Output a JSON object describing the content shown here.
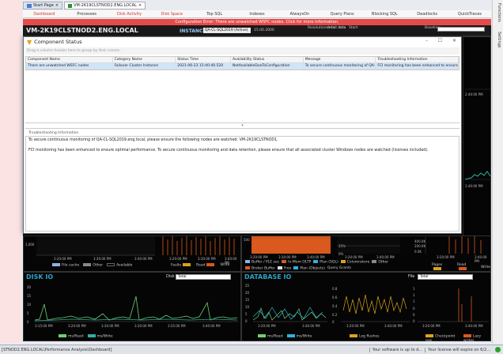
{
  "tabs": [
    {
      "label": "Start Page"
    },
    {
      "label": "VM-2K19CLSTNOD2.ENG.LOCAL"
    }
  ],
  "nav": [
    "Dashboard",
    "Processes",
    "Disk Activity",
    "Disk Space",
    "Top SQL",
    "Indexes",
    "AlwaysOn",
    "Query Plans",
    "Blocking SQL",
    "Deadlocks",
    "QuickTraces"
  ],
  "error_text": "Configuration Error: There are unwatched WSFC nodes. Click for more information.",
  "server": {
    "name": "VM-2K19CLSTNOD2.ENG.LOCAL",
    "instance_label": "INSTANCE",
    "instance_value": "QA-CL-SQL2019 (Active)",
    "date": "15.00.2000",
    "resolution_label": "Resolution:",
    "resolution_value": "detail data",
    "start_label": "Start:",
    "baseline_label": "Baseline:"
  },
  "right_labels": {
    "functions": "Functions",
    "settings": "Settings"
  },
  "modal": {
    "title": "Component Status",
    "group_hint": "Drag a column header here to group by that column",
    "columns": [
      "Component Name",
      "Category Name",
      "Status Time",
      "Availability Status",
      "Message",
      "Troubleshooting Information"
    ],
    "rows": [
      [
        "There are unwatched WSFC nodes",
        "Failover Cluster Instance",
        "2021-06-23 15:40:40.520",
        "NotAvailableDueToConfiguration",
        "To secure continuous monitoring of QA-C...",
        "FCI monitoring has been enhanced to ensure ..."
      ]
    ],
    "ts_header": "Troubleshooting Information",
    "ts_lines": [
      "To secure continuous monitoring of QA-CL-SQL2019.eng.local, please ensure the following nodes are watched: VM-2K19CLSTNOD1.",
      "FCI monitoring has been enhanced to ensure optimal performance. To secure continuous monitoring and data retention, please ensure that all associated cluster Windows nodes are watched (licenses included)."
    ]
  },
  "memory_panel": {
    "tick_left": "1,000",
    "times": [
      "3:20:00 PM",
      "3:30:00 PM",
      "3:40:00 PM"
    ],
    "legend": [
      "File cache",
      "Other",
      "Available"
    ],
    "legend2": [
      "Faults",
      "Read",
      "Write"
    ]
  },
  "sql_panel": {
    "tick": "500",
    "times": [
      "3:20:00 PM",
      "3:30:00 PM",
      "3:40:00 PM"
    ],
    "pct": [
      "25%",
      "0%"
    ],
    "legend": [
      "Buffer / PLE sec",
      "In-Mem OLTP",
      "Plan (SQL)",
      "Columnstore",
      "Other",
      "Broker Buffer",
      "Free",
      "Plan (Objects)",
      "Query Grants"
    ],
    "right_ticks": [
      "400.0K",
      "200.0K",
      "0.0K"
    ],
    "right_times": [
      "3:20:00 PM",
      "3:30:00 PM",
      "3:40:00 PM"
    ],
    "right_legend": [
      "Pages",
      "Read",
      "Write"
    ]
  },
  "disk_io": {
    "title": "DISK IO",
    "select_label": "Disk",
    "select_value": "Total",
    "yticks": [
      "20",
      "15",
      "10",
      "5",
      "0"
    ],
    "times": [
      "3:15:00 PM",
      "3:20:00 PM",
      "3:30:00 PM",
      "3:30:00 PM",
      "3:35:00 PM",
      "3:40:00 PM"
    ],
    "legend": [
      "ms/Read",
      "ms/Write"
    ]
  },
  "database_io": {
    "title": "DATABASE IO",
    "select_label": "File",
    "select_value": "Total",
    "yticks": [
      "25",
      "20",
      "15",
      "10",
      "5",
      "0"
    ],
    "yticks2": [
      "0.8",
      "0.6",
      "0.4",
      "0.2",
      "0"
    ],
    "yticks3": [
      "1",
      "1",
      "1",
      "0",
      "0",
      "0"
    ],
    "times": [
      "3:20:00 PM",
      "3:40:00 PM",
      "3:20:00 PM",
      "3:40:00 PM",
      "3:20:00 PM",
      "3:40:00 PM"
    ],
    "legend": [
      "ms/Read",
      "ms/Write",
      "Log flushes",
      "Checkpoint pgs",
      "Lazy writes"
    ]
  },
  "time_label": "2:40:00 PM",
  "status": {
    "path": "[STNOD2.ENG.LOCAL\\Performance Analysis\\Dashboard]",
    "msg1": "Your software is up to d...",
    "msg2": "Your license will expire on 6/2..."
  },
  "colors": {
    "accent": "#2ea3c8",
    "error": "#e64b4b",
    "orange": "#d9591e",
    "green": "#6fd16f",
    "teal": "#2fb1a3",
    "gold": "#d8a21c"
  }
}
